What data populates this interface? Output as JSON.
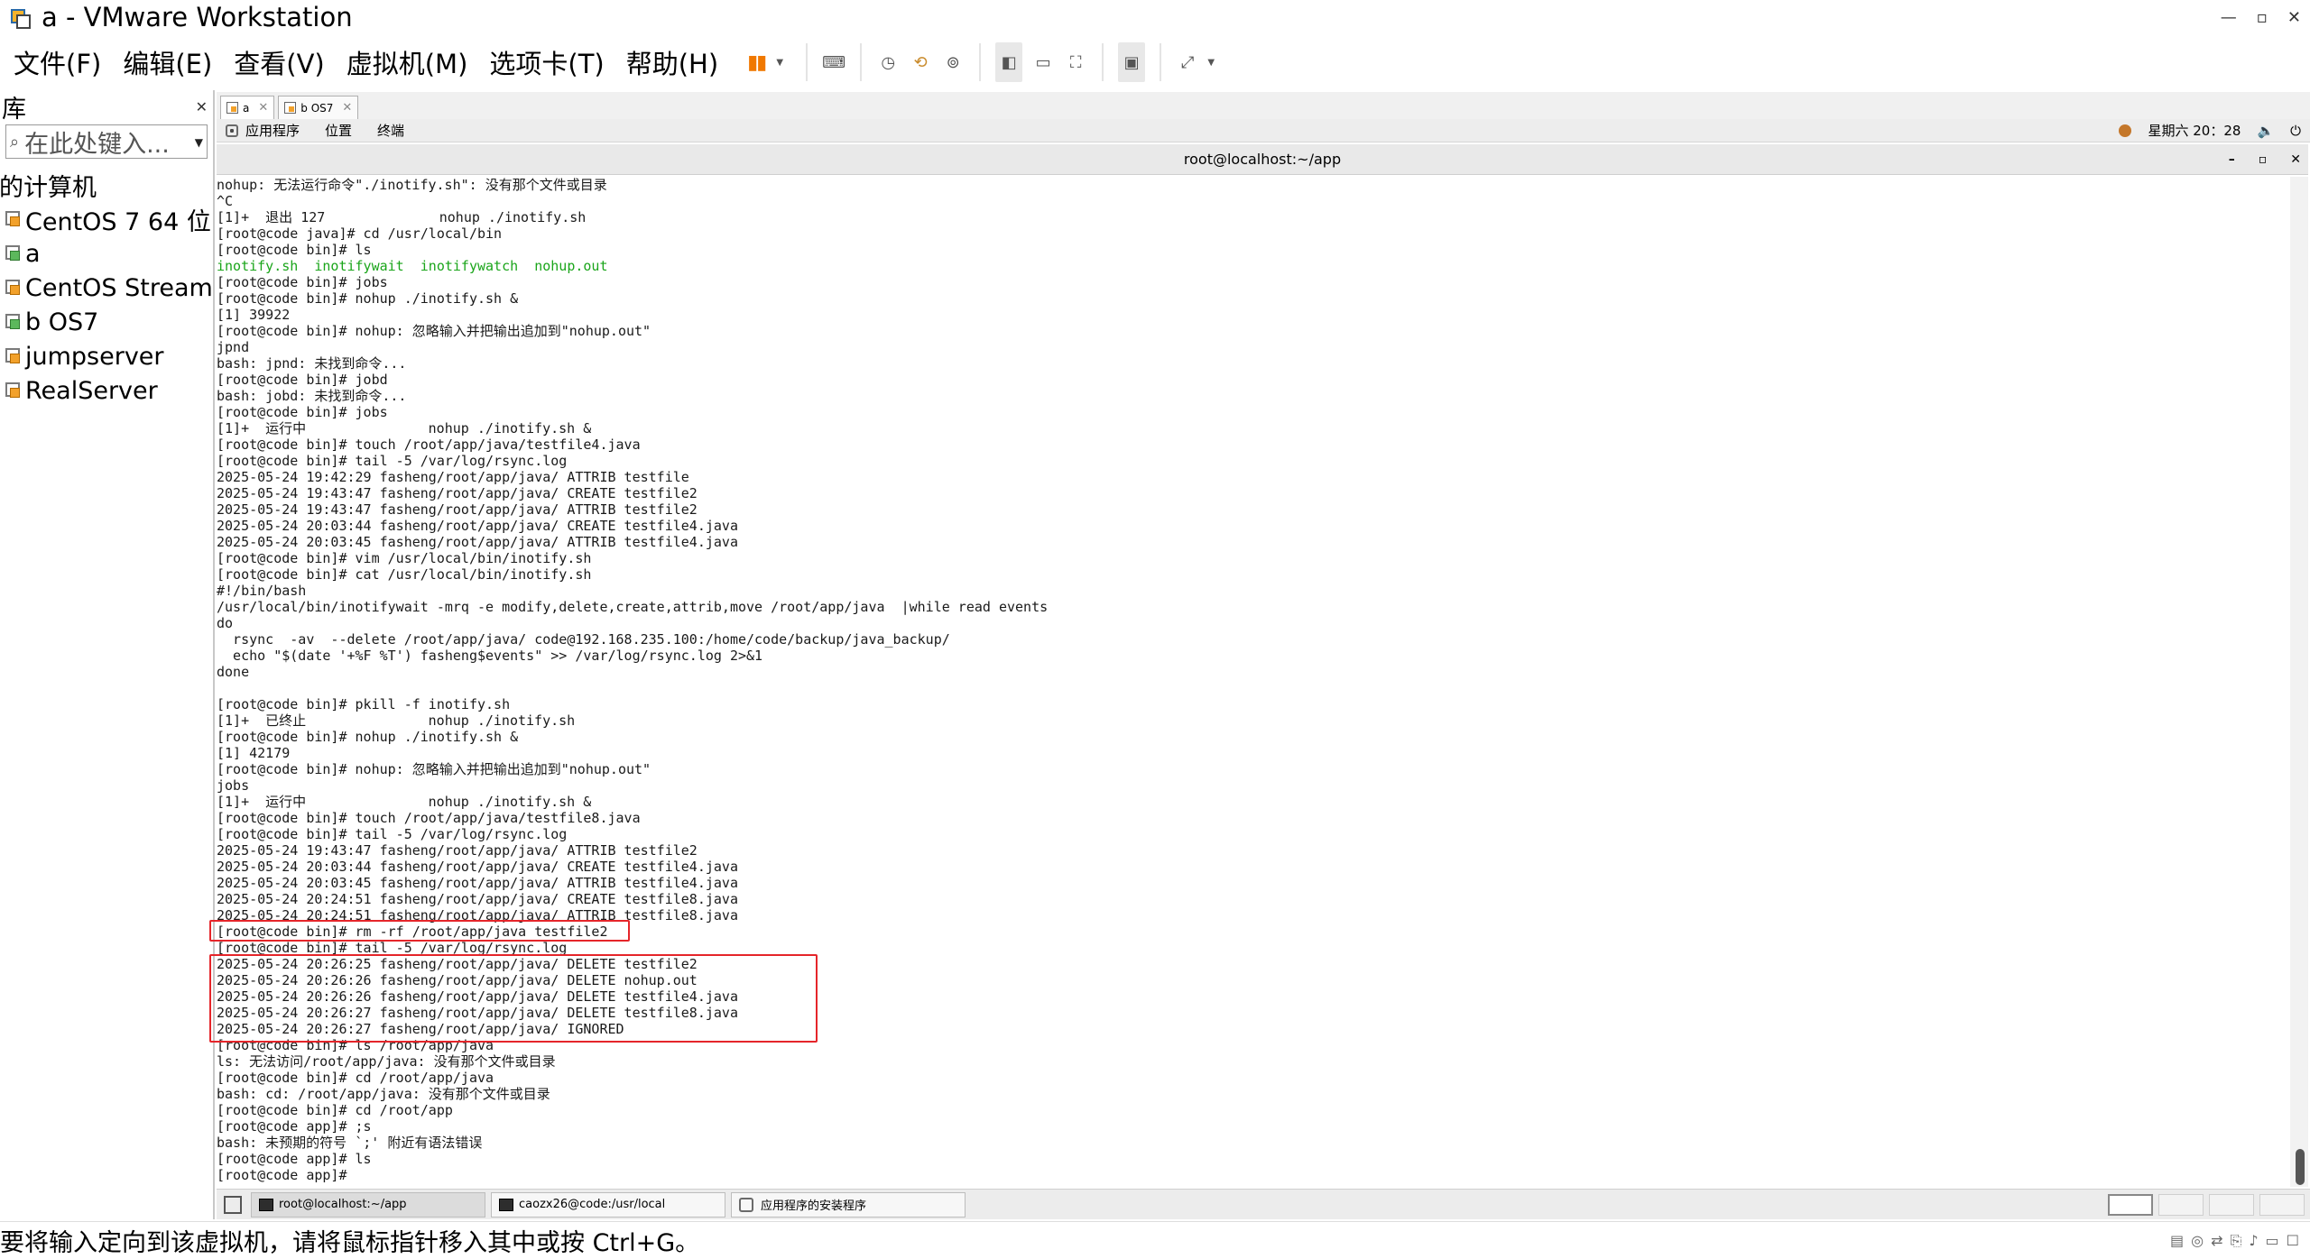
{
  "window": {
    "title": "a - VMware Workstation"
  },
  "menu": [
    "文件(F)",
    "编辑(E)",
    "查看(V)",
    "虚拟机(M)",
    "选项卡(T)",
    "帮助(H)"
  ],
  "library": {
    "title": "库",
    "search_placeholder": "在此处键入...",
    "root": "我的计算机",
    "vms": [
      "CentOS 7 64 位",
      "a",
      "CentOS Stream",
      "b OS7",
      "jumpserver",
      "RealServer"
    ]
  },
  "vm_tabs": [
    "a",
    "b OS7"
  ],
  "guest_panel": {
    "apps": "应用程序",
    "places": "位置",
    "terminal": "终端",
    "clock": "星期六 20：28"
  },
  "terminal": {
    "title": "root@localhost:~/app",
    "lines": [
      "nohup: 无法运行命令\"./inotify.sh\": 没有那个文件或目录",
      "^C",
      "[1]+  退出 127              nohup ./inotify.sh",
      "[root@code java]# cd /usr/local/bin",
      "[root@code bin]# ls",
      "inotify.sh  inotifywait  inotifywatch  nohup.out",
      "[root@code bin]# jobs",
      "[root@code bin]# nohup ./inotify.sh &",
      "[1] 39922",
      "[root@code bin]# nohup: 忽略输入并把输出追加到\"nohup.out\"",
      "jpnd",
      "bash: jpnd: 未找到命令...",
      "[root@code bin]# jobd",
      "bash: jobd: 未找到命令...",
      "[root@code bin]# jobs",
      "[1]+  运行中               nohup ./inotify.sh &",
      "[root@code bin]# touch /root/app/java/testfile4.java",
      "[root@code bin]# tail -5 /var/log/rsync.log",
      "2025-05-24 19:42:29 fasheng/root/app/java/ ATTRIB testfile",
      "2025-05-24 19:43:47 fasheng/root/app/java/ CREATE testfile2",
      "2025-05-24 19:43:47 fasheng/root/app/java/ ATTRIB testfile2",
      "2025-05-24 20:03:44 fasheng/root/app/java/ CREATE testfile4.java",
      "2025-05-24 20:03:45 fasheng/root/app/java/ ATTRIB testfile4.java",
      "[root@code bin]# vim /usr/local/bin/inotify.sh",
      "[root@code bin]# cat /usr/local/bin/inotify.sh",
      "#!/bin/bash",
      "/usr/local/bin/inotifywait -mrq -e modify,delete,create,attrib,move /root/app/java  |while read events",
      "do",
      "  rsync  -av  --delete /root/app/java/ code@192.168.235.100:/home/code/backup/java_backup/",
      "  echo \"$(date '+%F %T') fasheng$events\" >> /var/log/rsync.log 2>&1",
      "done",
      "",
      "[root@code bin]# pkill -f inotify.sh",
      "[1]+  已终止               nohup ./inotify.sh",
      "[root@code bin]# nohup ./inotify.sh &",
      "[1] 42179",
      "[root@code bin]# nohup: 忽略输入并把输出追加到\"nohup.out\"",
      "jobs",
      "[1]+  运行中               nohup ./inotify.sh &",
      "[root@code bin]# touch /root/app/java/testfile8.java",
      "[root@code bin]# tail -5 /var/log/rsync.log",
      "2025-05-24 19:43:47 fasheng/root/app/java/ ATTRIB testfile2",
      "2025-05-24 20:03:44 fasheng/root/app/java/ CREATE testfile4.java",
      "2025-05-24 20:03:45 fasheng/root/app/java/ ATTRIB testfile4.java",
      "2025-05-24 20:24:51 fasheng/root/app/java/ CREATE testfile8.java",
      "2025-05-24 20:24:51 fasheng/root/app/java/ ATTRIB testfile8.java",
      "[root@code bin]# rm -rf /root/app/java testfile2",
      "[root@code bin]# tail -5 /var/log/rsync.log",
      "2025-05-24 20:26:25 fasheng/root/app/java/ DELETE testfile2",
      "2025-05-24 20:26:26 fasheng/root/app/java/ DELETE nohup.out",
      "2025-05-24 20:26:26 fasheng/root/app/java/ DELETE testfile4.java",
      "2025-05-24 20:26:27 fasheng/root/app/java/ DELETE testfile8.java",
      "2025-05-24 20:26:27 fasheng/root/app/java/ IGNORED",
      "[root@code bin]# ls /root/app/java",
      "ls: 无法访问/root/app/java: 没有那个文件或目录",
      "[root@code bin]# cd /root/app/java",
      "bash: cd: /root/app/java: 没有那个文件或目录",
      "[root@code bin]# cd /root/app",
      "[root@code app]# ;s",
      "bash: 未预期的符号 `;' 附近有语法错误",
      "[root@code app]# ls",
      "[root@code app]# "
    ]
  },
  "guest_taskbar": [
    "root@localhost:~/app",
    "caozx26@code:/usr/local",
    "应用程序的安装程序"
  ],
  "status": {
    "message": "要将输入定向到该虚拟机，请将鼠标指针移入其中或按 Ctrl+G。"
  },
  "colors": {
    "highlight": "#e5252a",
    "ls_green": "#1aa51a",
    "pause_orange": "#f07800"
  }
}
